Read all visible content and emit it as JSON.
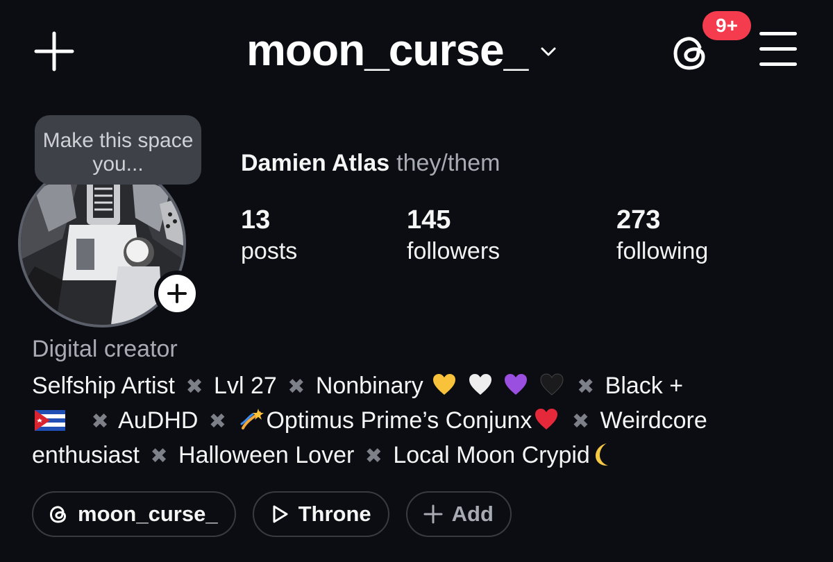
{
  "header": {
    "username": "moon_curse_",
    "notification_badge": "9+",
    "icons": {
      "create": "plus-icon",
      "switch": "chevron-down-icon",
      "threads": "threads-icon",
      "menu": "hamburger-menu-icon"
    }
  },
  "profile": {
    "tooltip": "Make this space you...",
    "display_name": "Damien Atlas",
    "pronouns": "they/them",
    "stats": [
      {
        "value": "13",
        "label": "posts"
      },
      {
        "value": "145",
        "label": "followers"
      },
      {
        "value": "273",
        "label": "following"
      }
    ],
    "category": "Digital creator",
    "bio": {
      "t1": "Selfship Artist",
      "t2": "Lvl 27",
      "t3": "Nonbinary",
      "t4": "Black +",
      "t5": "AuDHD",
      "t6": "Optimus Prime’s Conjunx",
      "t7": "Weirdcore",
      "t8": "enthusiast",
      "t9": "Halloween Lover",
      "t10": "Local Moon Crypid",
      "separator": "✖",
      "emoji": [
        "yellow-heart",
        "white-heart",
        "purple-heart",
        "black-heart",
        "cuba-flag",
        "dizzy",
        "red-heart",
        "crescent-moon"
      ]
    }
  },
  "links": [
    {
      "label": "moon_curse_",
      "icon": "threads-icon"
    },
    {
      "label": "Throne",
      "icon": "play-outline-icon"
    },
    {
      "label": "Add",
      "icon": "plus-icon"
    }
  ],
  "colors": {
    "background": "#0c0d12",
    "badge": "#f53c4e",
    "muted_text": "#a8abb3",
    "separator": "#7d8089"
  }
}
